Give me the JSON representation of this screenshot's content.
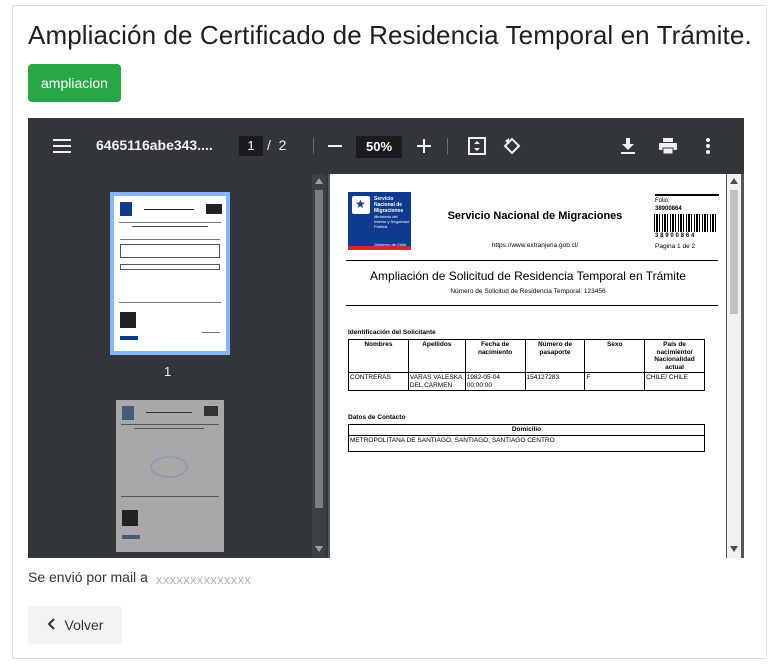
{
  "page": {
    "title": "Ampliación de Certificado de Residencia Temporal en Trámite.",
    "tag_button": "ampliacion",
    "sent_label": "Se envió por mail a",
    "sent_email": "xxxxxxxxxxxxxx",
    "back_label": "Volver"
  },
  "viewer": {
    "file_name": "6465116abe343....",
    "current_page": "1",
    "page_separator": "/",
    "total_pages": "2",
    "zoom": "50%",
    "thumb_number": "1"
  },
  "pdf": {
    "service_name": "Servicio Nacional de Migraciones",
    "url": "https://www.extranjeria.gob.cl/",
    "logo_title": "Servicio Nacional de Migraciones",
    "logo_subtitle": "Ministerio del Interior y Seguridad Pública",
    "logo_footer": "Gobierno de Chile",
    "folio_label": "Folio:",
    "folio_number": "38900864",
    "barcode_digits": "38900864",
    "page_label": "Pagina 1 de 2",
    "doc_title": "Ampliación de Solicitud de Residencia Temporal en Trámite",
    "doc_subtitle": "Número de Solicitud de Residencia Temporal: 123456",
    "applicant_section": "Identificación del Solicitante",
    "applicant_headers": [
      "Nombres",
      "Apellidos",
      "Fecha de nacimiento",
      "Número de pasaporte",
      "Sexo",
      "País de nacimiento/ Nacionalidad actual"
    ],
    "applicant_row": [
      "CONTRERAS",
      "VARAS VALESKA DEL CARMEN",
      "1982-05-04 00:00:00",
      "154127283",
      "F",
      "CHILE/ CHILE"
    ],
    "contact_section": "Datos de Contacto",
    "contact_header": "Domicilio",
    "contact_value": "METROPOLITANA DE SANTIAGO, SANTIAGO, SANTIAGO CENTRO"
  }
}
